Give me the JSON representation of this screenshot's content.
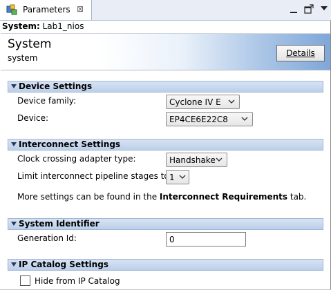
{
  "tab": {
    "label": "Parameters",
    "close": "⊠"
  },
  "system_line": {
    "prefix": "System:",
    "name": "Lab1_nios"
  },
  "header": {
    "title": "System",
    "subtitle": "system",
    "details_button": "Details"
  },
  "sections": {
    "device": {
      "title": "Device Settings",
      "family_label": "Device family:",
      "family_value": "Cyclone IV E",
      "device_label": "Device:",
      "device_value": "EP4CE6E22C8"
    },
    "interconnect": {
      "title": "Interconnect Settings",
      "clock_label": "Clock crossing adapter type:",
      "clock_value": "Handshake",
      "pipeline_label": "Limit interconnect pipeline stages to:",
      "pipeline_value": "1",
      "info_prefix": "More settings can be found in the ",
      "info_bold": "Interconnect Requirements",
      "info_suffix": " tab."
    },
    "identifier": {
      "title": "System Identifier",
      "gen_label": "Generation Id:",
      "gen_value": "0"
    },
    "catalog": {
      "title": "IP Catalog Settings",
      "hide_label": "Hide from IP Catalog",
      "hide_checked": false
    }
  }
}
